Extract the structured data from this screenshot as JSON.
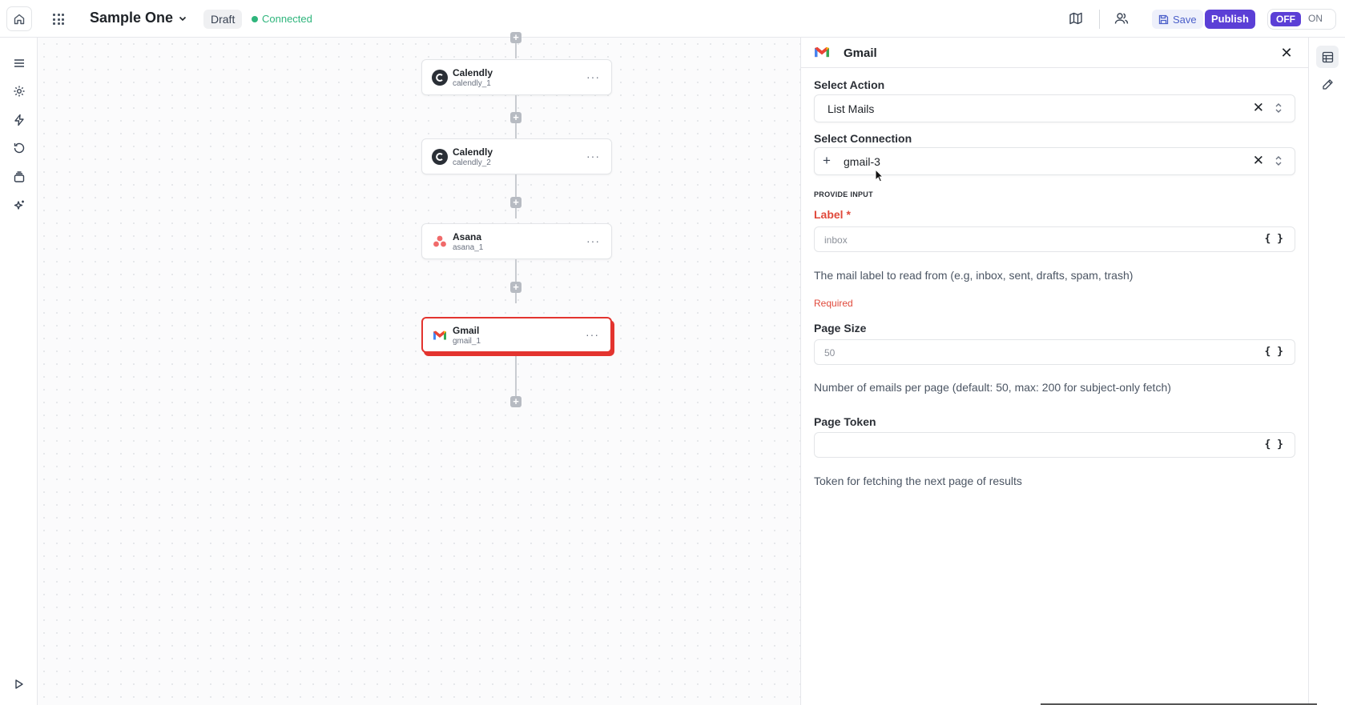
{
  "header": {
    "title": "Sample One",
    "draft_label": "Draft",
    "status_label": "Connected",
    "save_label": "Save",
    "publish_label": "Publish",
    "toggle_off": "OFF",
    "toggle_on": "ON"
  },
  "colors": {
    "accent": "#5b3fd6",
    "connected": "#2fb57c",
    "selected_border": "#e3342f",
    "required": "#e0493b"
  },
  "workflow": {
    "nodes": [
      {
        "title": "Calendly",
        "id": "calendly_1",
        "icon": "calendly-icon"
      },
      {
        "title": "Calendly",
        "id": "calendly_2",
        "icon": "calendly-icon"
      },
      {
        "title": "Asana",
        "id": "asana_1",
        "icon": "asana-icon"
      },
      {
        "title": "Gmail",
        "id": "gmail_1",
        "icon": "gmail-icon"
      }
    ],
    "selected_node": "gmail_1",
    "node_menu": "···",
    "plus_glyph": "+"
  },
  "panel": {
    "title": "Gmail",
    "select_action_label": "Select Action",
    "select_action_value": "List Mails",
    "select_connection_label": "Select Connection",
    "select_connection_value": "gmail-3",
    "provide_input_label": "PROVIDE INPUT",
    "fields": [
      {
        "label": "Label",
        "required_mark": "*",
        "placeholder": "inbox",
        "help": "The mail label to read from (e.g, inbox, sent, drafts, spam, trash)",
        "required_text": "Required"
      },
      {
        "label": "Page Size",
        "placeholder": "50",
        "help": "Number of emails per page (default: 50, max: 200 for subject-only fetch)"
      },
      {
        "label": "Page Token",
        "placeholder": "",
        "help": "Token for fetching the next page of results"
      }
    ],
    "braces": "{ }",
    "close_glyph": "✕",
    "clear_glyph": "✕",
    "add_glyph": "+"
  }
}
